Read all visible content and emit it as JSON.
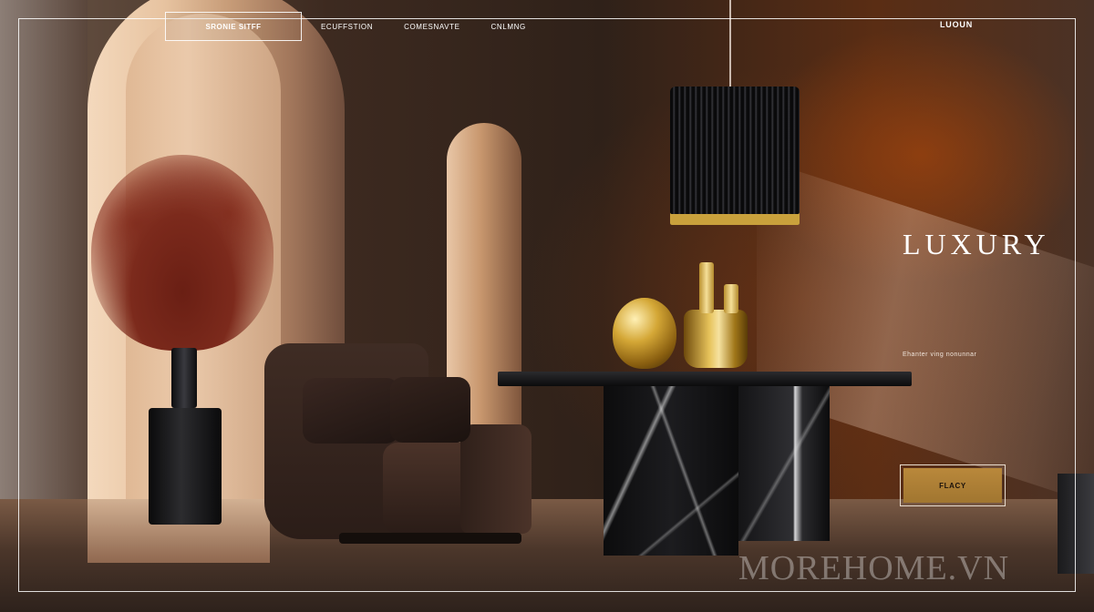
{
  "nav": {
    "box_label": "SRONIE SITFF",
    "links": [
      "ECUFFSTION",
      "COMESNAVTE",
      "CNLMNG"
    ],
    "brand": "LUOUN"
  },
  "hero": {
    "title": "LUXURY",
    "subtitle": "Ehanter ving nonunnar",
    "cta_label": "FLACY"
  },
  "watermark": "MOREHOME.VN",
  "colors": {
    "accent_gold": "#b9883b",
    "frame": "#ffffff",
    "wall_rust": "#96410f"
  },
  "icons": []
}
